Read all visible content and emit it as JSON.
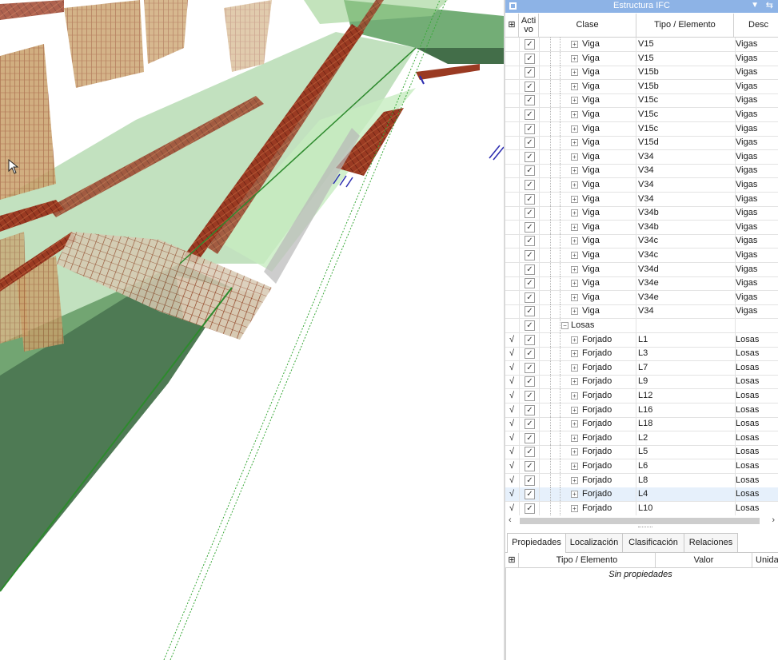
{
  "panel": {
    "title": "Estructura IFC",
    "header": {
      "col_icon": "grid-options-icon",
      "activo": "Acti vo",
      "clase": "Clase",
      "tipo": "Tipo / Elemento",
      "desc": "Desc"
    },
    "rows": [
      {
        "mark": "",
        "clase": "Viga",
        "tipo": "V15",
        "desc": "Vigas",
        "level": 2,
        "expander": "+"
      },
      {
        "mark": "",
        "clase": "Viga",
        "tipo": "V15",
        "desc": "Vigas",
        "level": 2,
        "expander": "+"
      },
      {
        "mark": "",
        "clase": "Viga",
        "tipo": "V15b",
        "desc": "Vigas",
        "level": 2,
        "expander": "+"
      },
      {
        "mark": "",
        "clase": "Viga",
        "tipo": "V15b",
        "desc": "Vigas",
        "level": 2,
        "expander": "+"
      },
      {
        "mark": "",
        "clase": "Viga",
        "tipo": "V15c",
        "desc": "Vigas",
        "level": 2,
        "expander": "+"
      },
      {
        "mark": "",
        "clase": "Viga",
        "tipo": "V15c",
        "desc": "Vigas",
        "level": 2,
        "expander": "+"
      },
      {
        "mark": "",
        "clase": "Viga",
        "tipo": "V15c",
        "desc": "Vigas",
        "level": 2,
        "expander": "+"
      },
      {
        "mark": "",
        "clase": "Viga",
        "tipo": "V15d",
        "desc": "Vigas",
        "level": 2,
        "expander": "+"
      },
      {
        "mark": "",
        "clase": "Viga",
        "tipo": "V34",
        "desc": "Vigas",
        "level": 2,
        "expander": "+"
      },
      {
        "mark": "",
        "clase": "Viga",
        "tipo": "V34",
        "desc": "Vigas",
        "level": 2,
        "expander": "+"
      },
      {
        "mark": "",
        "clase": "Viga",
        "tipo": "V34",
        "desc": "Vigas",
        "level": 2,
        "expander": "+"
      },
      {
        "mark": "",
        "clase": "Viga",
        "tipo": "V34",
        "desc": "Vigas",
        "level": 2,
        "expander": "+"
      },
      {
        "mark": "",
        "clase": "Viga",
        "tipo": "V34b",
        "desc": "Vigas",
        "level": 2,
        "expander": "+"
      },
      {
        "mark": "",
        "clase": "Viga",
        "tipo": "V34b",
        "desc": "Vigas",
        "level": 2,
        "expander": "+"
      },
      {
        "mark": "",
        "clase": "Viga",
        "tipo": "V34c",
        "desc": "Vigas",
        "level": 2,
        "expander": "+"
      },
      {
        "mark": "",
        "clase": "Viga",
        "tipo": "V34c",
        "desc": "Vigas",
        "level": 2,
        "expander": "+"
      },
      {
        "mark": "",
        "clase": "Viga",
        "tipo": "V34d",
        "desc": "Vigas",
        "level": 2,
        "expander": "+"
      },
      {
        "mark": "",
        "clase": "Viga",
        "tipo": "V34e",
        "desc": "Vigas",
        "level": 2,
        "expander": "+"
      },
      {
        "mark": "",
        "clase": "Viga",
        "tipo": "V34e",
        "desc": "Vigas",
        "level": 2,
        "expander": "+"
      },
      {
        "mark": "",
        "clase": "Viga",
        "tipo": "V34",
        "desc": "Vigas",
        "level": 2,
        "expander": "+"
      },
      {
        "mark": "",
        "clase": "Losas",
        "tipo": "",
        "desc": "",
        "level": 1,
        "expander": "−"
      },
      {
        "mark": "√",
        "clase": "Forjado",
        "tipo": "L1",
        "desc": "Losas",
        "level": 2,
        "expander": "+"
      },
      {
        "mark": "√",
        "clase": "Forjado",
        "tipo": "L3",
        "desc": "Losas",
        "level": 2,
        "expander": "+"
      },
      {
        "mark": "√",
        "clase": "Forjado",
        "tipo": "L7",
        "desc": "Losas",
        "level": 2,
        "expander": "+"
      },
      {
        "mark": "√",
        "clase": "Forjado",
        "tipo": "L9",
        "desc": "Losas",
        "level": 2,
        "expander": "+"
      },
      {
        "mark": "√",
        "clase": "Forjado",
        "tipo": "L12",
        "desc": "Losas",
        "level": 2,
        "expander": "+"
      },
      {
        "mark": "√",
        "clase": "Forjado",
        "tipo": "L16",
        "desc": "Losas",
        "level": 2,
        "expander": "+"
      },
      {
        "mark": "√",
        "clase": "Forjado",
        "tipo": "L18",
        "desc": "Losas",
        "level": 2,
        "expander": "+"
      },
      {
        "mark": "√",
        "clase": "Forjado",
        "tipo": "L2",
        "desc": "Losas",
        "level": 2,
        "expander": "+"
      },
      {
        "mark": "√",
        "clase": "Forjado",
        "tipo": "L5",
        "desc": "Losas",
        "level": 2,
        "expander": "+"
      },
      {
        "mark": "√",
        "clase": "Forjado",
        "tipo": "L6",
        "desc": "Losas",
        "level": 2,
        "expander": "+"
      },
      {
        "mark": "√",
        "clase": "Forjado",
        "tipo": "L8",
        "desc": "Losas",
        "level": 2,
        "expander": "+"
      },
      {
        "mark": "√",
        "clase": "Forjado",
        "tipo": "L4",
        "desc": "Losas",
        "level": 2,
        "expander": "+",
        "selected": true
      },
      {
        "mark": "√",
        "clase": "Forjado",
        "tipo": "L10",
        "desc": "Losas",
        "level": 2,
        "expander": "+"
      }
    ],
    "check_glyph": "✓",
    "tabs": [
      "Propiedades",
      "Localización",
      "Clasificación",
      "Relaciones"
    ],
    "active_tab": 0,
    "props_header": {
      "tipo": "Tipo / Elemento",
      "valor": "Valor",
      "unidad": "Unida"
    },
    "empty_text": "Sin propiedades"
  },
  "icons": {
    "cursor": "mouse-pointer-icon",
    "pin": "pin-icon",
    "dropdown": "dropdown-arrow-icon",
    "panel": "panel-icon"
  },
  "colors": {
    "title_bar": "#8db3e6",
    "selection": "#e6f0fb",
    "rebar": "#8b2a1a",
    "slab_green": "#6aa86a",
    "slab_dark": "#3f6f45"
  }
}
